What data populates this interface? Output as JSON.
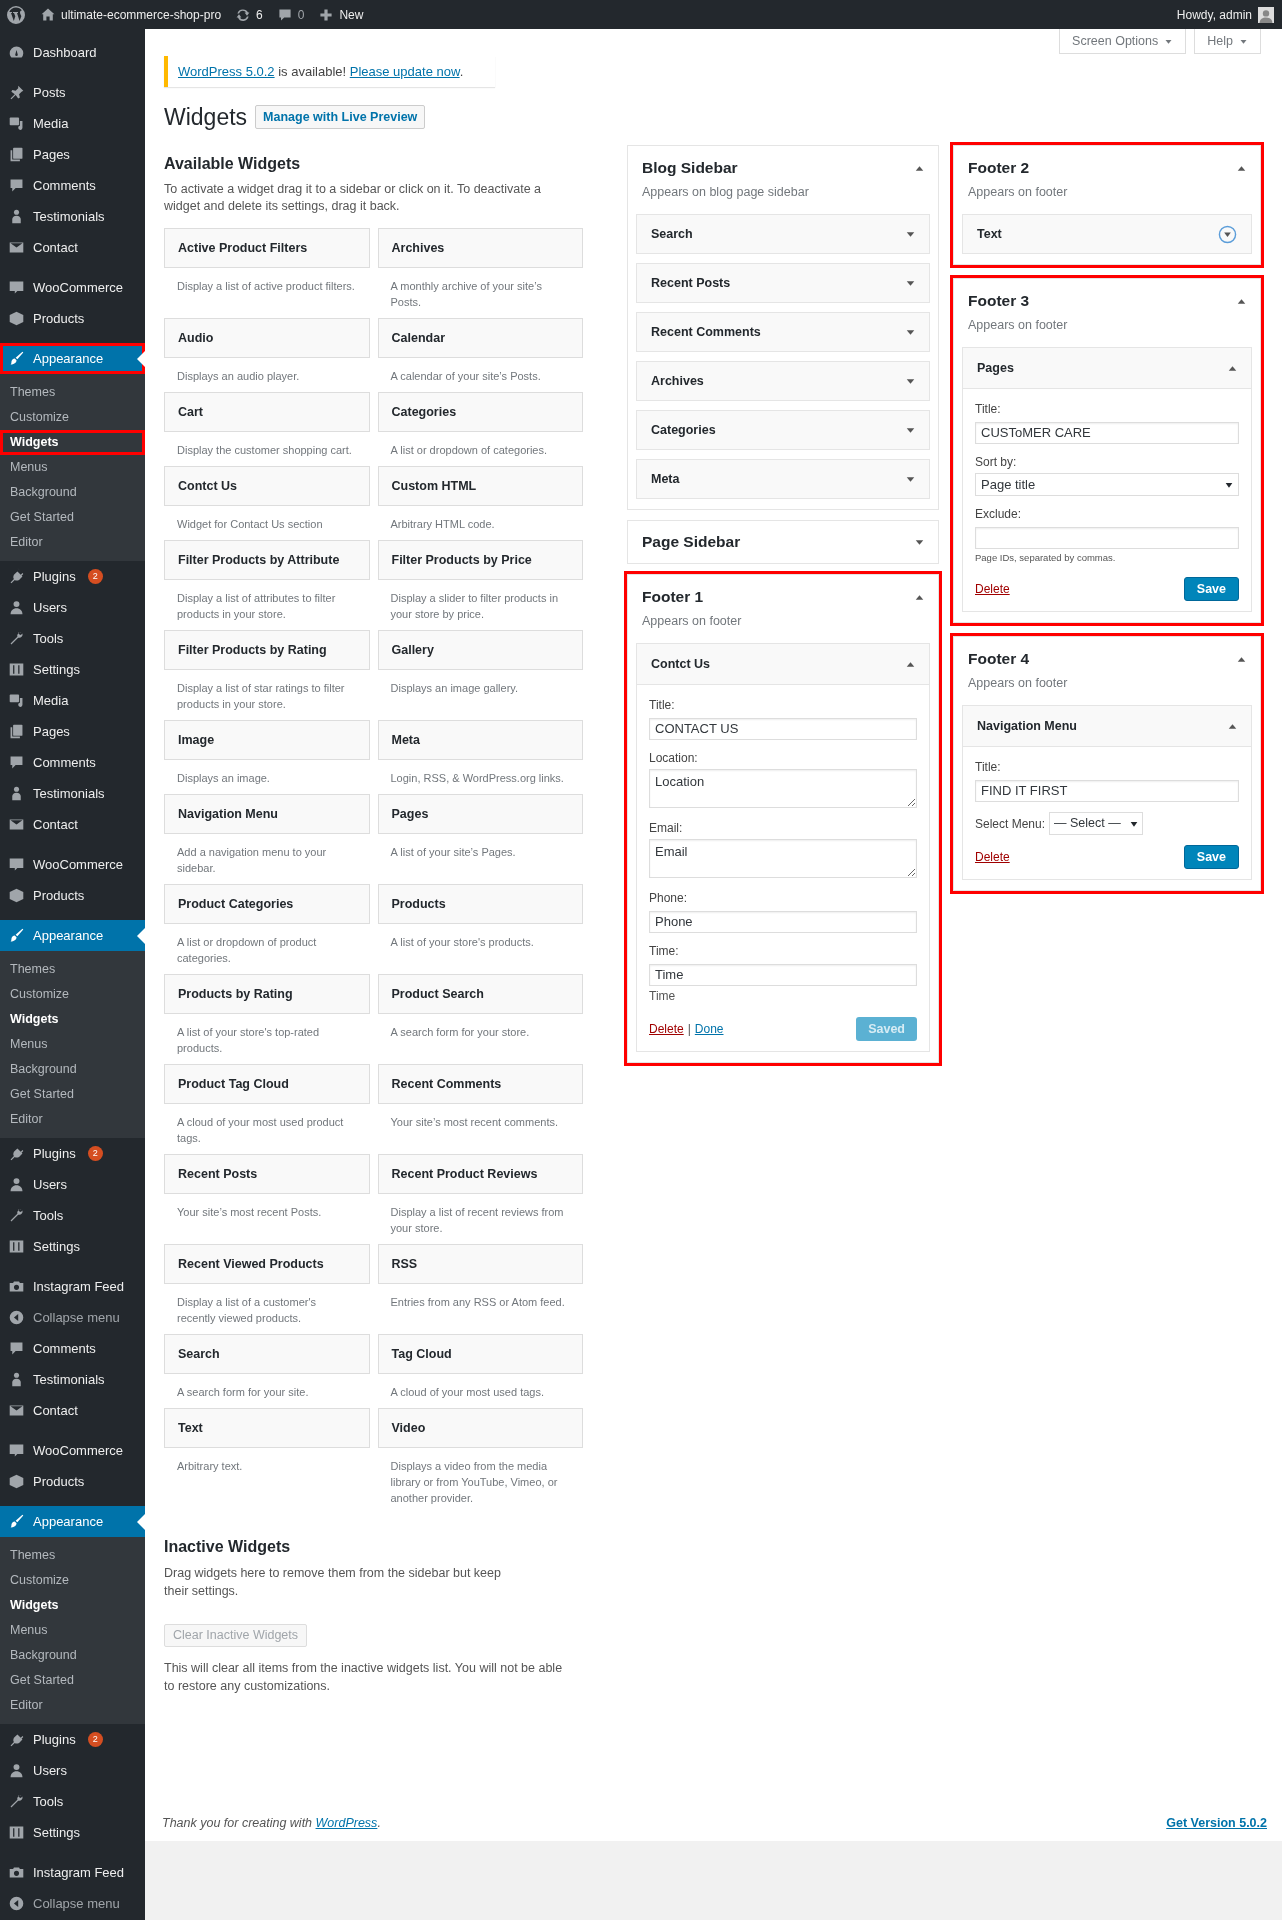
{
  "admin_bar": {
    "site": "ultimate-ecommerce-shop-pro",
    "updates": "6",
    "comments": "0",
    "new": "New",
    "greeting": "Howdy, admin"
  },
  "sidebar": [
    {
      "kind": "dashboard",
      "label": "Dashboard",
      "selected": false,
      "annotated": false
    },
    {
      "kind": "separator"
    },
    {
      "kind": "posts",
      "label": "Posts",
      "selected": false,
      "annotated": false
    },
    {
      "kind": "media",
      "label": "Media",
      "selected": false,
      "annotated": false
    },
    {
      "kind": "pages",
      "label": "Pages",
      "selected": false,
      "annotated": false
    },
    {
      "kind": "comments",
      "label": "Comments",
      "selected": false,
      "annotated": false
    },
    {
      "kind": "testimonials",
      "label": "Testimonials",
      "selected": false,
      "annotated": false
    },
    {
      "kind": "contact",
      "label": "Contact",
      "selected": false,
      "annotated": false
    },
    {
      "kind": "separator"
    },
    {
      "kind": "woocommerce",
      "label": "WooCommerce",
      "selected": false,
      "annotated": false
    },
    {
      "kind": "products",
      "label": "Products",
      "selected": false,
      "annotated": false
    },
    {
      "kind": "separator"
    },
    {
      "kind": "appearance",
      "label": "Appearance",
      "selected": true,
      "annotated": true,
      "children": [
        {
          "label": "Themes",
          "selected": false,
          "annotated": false
        },
        {
          "label": "Customize",
          "selected": false,
          "annotated": false
        },
        {
          "label": "Widgets",
          "selected": true,
          "annotated": true
        },
        {
          "label": "Menus",
          "selected": false,
          "annotated": false
        },
        {
          "label": "Background",
          "selected": false,
          "annotated": false
        },
        {
          "label": "Get Started",
          "selected": false,
          "annotated": false
        },
        {
          "label": "Editor",
          "selected": false,
          "annotated": false
        }
      ]
    },
    {
      "kind": "plugins",
      "label": "Plugins",
      "badge": "2",
      "selected": false,
      "annotated": false
    },
    {
      "kind": "users",
      "label": "Users",
      "selected": false,
      "annotated": false
    },
    {
      "kind": "tools",
      "label": "Tools",
      "selected": false,
      "annotated": false
    },
    {
      "kind": "settings",
      "label": "Settings",
      "selected": false,
      "annotated": false
    },
    {
      "kind": "media",
      "label": "Media",
      "selected": false,
      "annotated": false
    },
    {
      "kind": "pages",
      "label": "Pages",
      "selected": false,
      "annotated": false
    },
    {
      "kind": "comments",
      "label": "Comments",
      "selected": false,
      "annotated": false
    },
    {
      "kind": "testimonials",
      "label": "Testimonials",
      "selected": false,
      "annotated": false
    },
    {
      "kind": "contact",
      "label": "Contact",
      "selected": false,
      "annotated": false
    },
    {
      "kind": "separator"
    },
    {
      "kind": "woocommerce",
      "label": "WooCommerce",
      "selected": false,
      "annotated": false
    },
    {
      "kind": "products",
      "label": "Products",
      "selected": false,
      "annotated": false
    },
    {
      "kind": "separator"
    },
    {
      "kind": "appearance",
      "label": "Appearance",
      "selected": true,
      "annotated": false,
      "children": [
        {
          "label": "Themes",
          "selected": false,
          "annotated": false
        },
        {
          "label": "Customize",
          "selected": false,
          "annotated": false
        },
        {
          "label": "Widgets",
          "selected": true,
          "annotated": false
        },
        {
          "label": "Menus",
          "selected": false,
          "annotated": false
        },
        {
          "label": "Background",
          "selected": false,
          "annotated": false
        },
        {
          "label": "Get Started",
          "selected": false,
          "annotated": false
        },
        {
          "label": "Editor",
          "selected": false,
          "annotated": false
        }
      ]
    },
    {
      "kind": "plugins",
      "label": "Plugins",
      "badge": "2",
      "selected": false,
      "annotated": false
    },
    {
      "kind": "users",
      "label": "Users",
      "selected": false,
      "annotated": false
    },
    {
      "kind": "tools",
      "label": "Tools",
      "selected": false,
      "annotated": false
    },
    {
      "kind": "settings",
      "label": "Settings",
      "selected": false,
      "annotated": false
    },
    {
      "kind": "separator"
    },
    {
      "kind": "instagram",
      "label": "Instagram Feed",
      "selected": false,
      "annotated": false
    },
    {
      "kind": "collapse",
      "label": "Collapse menu",
      "selected": false,
      "annotated": false
    },
    {
      "kind": "comments",
      "label": "Comments",
      "selected": false,
      "annotated": false
    },
    {
      "kind": "testimonials",
      "label": "Testimonials",
      "selected": false,
      "annotated": false
    },
    {
      "kind": "contact",
      "label": "Contact",
      "selected": false,
      "annotated": false
    },
    {
      "kind": "separator"
    },
    {
      "kind": "woocommerce",
      "label": "WooCommerce",
      "selected": false,
      "annotated": false
    },
    {
      "kind": "products",
      "label": "Products",
      "selected": false,
      "annotated": false
    },
    {
      "kind": "separator"
    },
    {
      "kind": "appearance",
      "label": "Appearance",
      "selected": true,
      "annotated": false,
      "children": [
        {
          "label": "Themes",
          "selected": false,
          "annotated": false
        },
        {
          "label": "Customize",
          "selected": false,
          "annotated": false
        },
        {
          "label": "Widgets",
          "selected": true,
          "annotated": false
        },
        {
          "label": "Menus",
          "selected": false,
          "annotated": false
        },
        {
          "label": "Background",
          "selected": false,
          "annotated": false
        },
        {
          "label": "Get Started",
          "selected": false,
          "annotated": false
        },
        {
          "label": "Editor",
          "selected": false,
          "annotated": false
        }
      ]
    },
    {
      "kind": "plugins",
      "label": "Plugins",
      "badge": "2",
      "selected": false,
      "annotated": false
    },
    {
      "kind": "users",
      "label": "Users",
      "selected": false,
      "annotated": false
    },
    {
      "kind": "tools",
      "label": "Tools",
      "selected": false,
      "annotated": false
    },
    {
      "kind": "settings",
      "label": "Settings",
      "selected": false,
      "annotated": false
    },
    {
      "kind": "separator"
    },
    {
      "kind": "instagram",
      "label": "Instagram Feed",
      "selected": false,
      "annotated": false
    },
    {
      "kind": "collapse",
      "label": "Collapse menu",
      "selected": false,
      "annotated": false
    }
  ],
  "screen_tabs": [
    "Screen Options",
    "Help"
  ],
  "notice": {
    "version_link": "WordPress 5.0.2",
    "text": " is available! ",
    "update_link": "Please update now",
    "end": "."
  },
  "page_title": "Widgets",
  "live_preview_button": "Manage with Live Preview",
  "available": {
    "title": "Available Widgets",
    "description": "To activate a widget drag it to a sidebar or click on it. To deactivate a widget and delete its settings, drag it back.",
    "widgets": [
      {
        "title": "Active Product Filters",
        "description": "Display a list of active product filters."
      },
      {
        "title": "Archives",
        "description": "A monthly archive of your site’s Posts."
      },
      {
        "title": "Audio",
        "description": "Displays an audio player."
      },
      {
        "title": "Calendar",
        "description": "A calendar of your site’s Posts."
      },
      {
        "title": "Cart",
        "description": "Display the customer shopping cart."
      },
      {
        "title": "Categories",
        "description": "A list or dropdown of categories."
      },
      {
        "title": "Contct Us",
        "description": "Widget for Contact Us section"
      },
      {
        "title": "Custom HTML",
        "description": "Arbitrary HTML code."
      },
      {
        "title": "Filter Products by Attribute",
        "description": "Display a list of attributes to filter products in your store."
      },
      {
        "title": "Filter Products by Price",
        "description": "Display a slider to filter products in your store by price."
      },
      {
        "title": "Filter Products by Rating",
        "description": "Display a list of star ratings to filter products in your store."
      },
      {
        "title": "Gallery",
        "description": "Displays an image gallery."
      },
      {
        "title": "Image",
        "description": "Displays an image."
      },
      {
        "title": "Meta",
        "description": "Login, RSS, & WordPress.org links."
      },
      {
        "title": "Navigation Menu",
        "description": "Add a navigation menu to your sidebar."
      },
      {
        "title": "Pages",
        "description": "A list of your site’s Pages."
      },
      {
        "title": "Product Categories",
        "description": "A list or dropdown of product categories."
      },
      {
        "title": "Products",
        "description": "A list of your store's products."
      },
      {
        "title": "Products by Rating",
        "description": "A list of your store's top-rated products."
      },
      {
        "title": "Product Search",
        "description": "A search form for your store."
      },
      {
        "title": "Product Tag Cloud",
        "description": "A cloud of your most used product tags."
      },
      {
        "title": "Recent Comments",
        "description": "Your site’s most recent comments."
      },
      {
        "title": "Recent Posts",
        "description": "Your site’s most recent Posts."
      },
      {
        "title": "Recent Product Reviews",
        "description": "Display a list of recent reviews from your store."
      },
      {
        "title": "Recent Viewed Products",
        "description": "Display a list of a customer's recently viewed products."
      },
      {
        "title": "RSS",
        "description": "Entries from any RSS or Atom feed."
      },
      {
        "title": "Search",
        "description": "A search form for your site."
      },
      {
        "title": "Tag Cloud",
        "description": "A cloud of your most used tags."
      },
      {
        "title": "Text",
        "description": "Arbitrary text."
      },
      {
        "title": "Video",
        "description": "Displays a video from the media library or from YouTube, Vimeo, or another provider."
      }
    ]
  },
  "inactive": {
    "title": "Inactive Widgets",
    "description": "Drag widgets here to remove them from the sidebar but keep their settings.",
    "button": {
      "label": "Clear Inactive Widgets",
      "disabled": true
    },
    "note": "This will clear all items from the inactive widgets list. You will not be able to restore any customizations."
  },
  "widget_area_columns": [
    [
      {
        "title": "Blog Sidebar",
        "description": "Appears on blog page sidebar",
        "expanded": true,
        "annotated": false,
        "widgets": [
          {
            "title": "Search",
            "expanded": false,
            "focused": false
          },
          {
            "title": "Recent Posts",
            "expanded": false,
            "focused": false
          },
          {
            "title": "Recent Comments",
            "expanded": false,
            "focused": false
          },
          {
            "title": "Archives",
            "expanded": false,
            "focused": false
          },
          {
            "title": "Categories",
            "expanded": false,
            "focused": false
          },
          {
            "title": "Meta",
            "expanded": false,
            "focused": false
          }
        ]
      },
      {
        "title": "Page Sidebar",
        "expanded": false,
        "annotated": false
      },
      {
        "title": "Footer 1",
        "description": "Appears on footer",
        "expanded": true,
        "annotated": true,
        "widgets": [
          {
            "title": "Contct Us",
            "expanded": true,
            "focused": false,
            "fields": [
              {
                "kind": "text",
                "label": "Title:",
                "value": "CONTACT US"
              },
              {
                "kind": "textarea",
                "label": "Location:",
                "value": "Location"
              },
              {
                "kind": "textarea",
                "label": "Email:",
                "value": "Email"
              },
              {
                "kind": "text",
                "label": "Phone:",
                "value": "Phone"
              },
              {
                "kind": "text",
                "label": "Time:",
                "value": "Time"
              },
              {
                "kind": "caption",
                "text": "Time"
              }
            ],
            "links": [
              {
                "kind": "delete",
                "label": "Delete"
              },
              {
                "kind": "done",
                "label": "Done"
              }
            ],
            "link_separator": "|",
            "save": {
              "label": "Saved",
              "disabled": true
            }
          }
        ]
      }
    ],
    [
      {
        "title": "Footer 2",
        "description": "Appears on footer",
        "expanded": true,
        "annotated": true,
        "widgets": [
          {
            "title": "Text",
            "expanded": false,
            "focused": true
          }
        ]
      },
      {
        "title": "Footer 3",
        "description": "Appears on footer",
        "expanded": true,
        "annotated": true,
        "widgets": [
          {
            "title": "Pages",
            "expanded": true,
            "focused": false,
            "fields": [
              {
                "kind": "text",
                "label": "Title:",
                "value": "CUSToMER CARE"
              },
              {
                "kind": "select",
                "label": "Sort by:",
                "value": "Page title"
              },
              {
                "kind": "text",
                "label": "Exclude:"
              },
              {
                "kind": "hint",
                "text": "Page IDs, separated by commas."
              }
            ],
            "links": [
              {
                "kind": "delete",
                "label": "Delete"
              }
            ],
            "save": {
              "label": "Save",
              "disabled": false
            }
          }
        ]
      },
      {
        "title": "Footer 4",
        "description": "Appears on footer",
        "expanded": true,
        "annotated": true,
        "widgets": [
          {
            "title": "Navigation Menu",
            "expanded": true,
            "focused": false,
            "fields": [
              {
                "kind": "text",
                "label": "Title:",
                "value": "FIND IT FIRST"
              },
              {
                "kind": "inline-select",
                "label": "Select Menu:",
                "value": "— Select —"
              }
            ],
            "links": [
              {
                "kind": "delete",
                "label": "Delete"
              }
            ],
            "save": {
              "label": "Save",
              "disabled": false
            }
          }
        ]
      }
    ]
  ],
  "footer": {
    "credit": {
      "text": "Thank you for creating with ",
      "link": "WordPress",
      "end": "."
    },
    "version_link": "Get Version 5.0.2"
  }
}
